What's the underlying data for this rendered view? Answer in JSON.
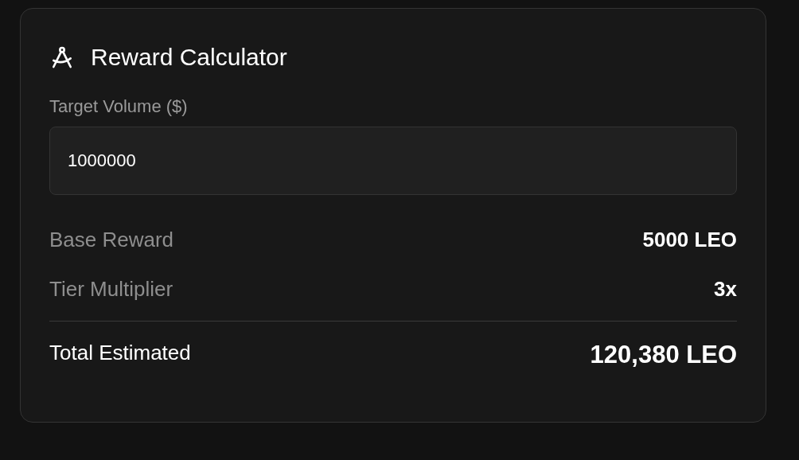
{
  "card": {
    "title": "Reward Calculator",
    "field": {
      "label": "Target Volume ($)",
      "value": "1000000"
    },
    "rows": [
      {
        "label": "Base Reward",
        "value": "5000 LEO"
      },
      {
        "label": "Tier Multiplier",
        "value": "3x"
      }
    ],
    "total": {
      "label": "Total Estimated",
      "value": "120,380 LEO"
    }
  }
}
